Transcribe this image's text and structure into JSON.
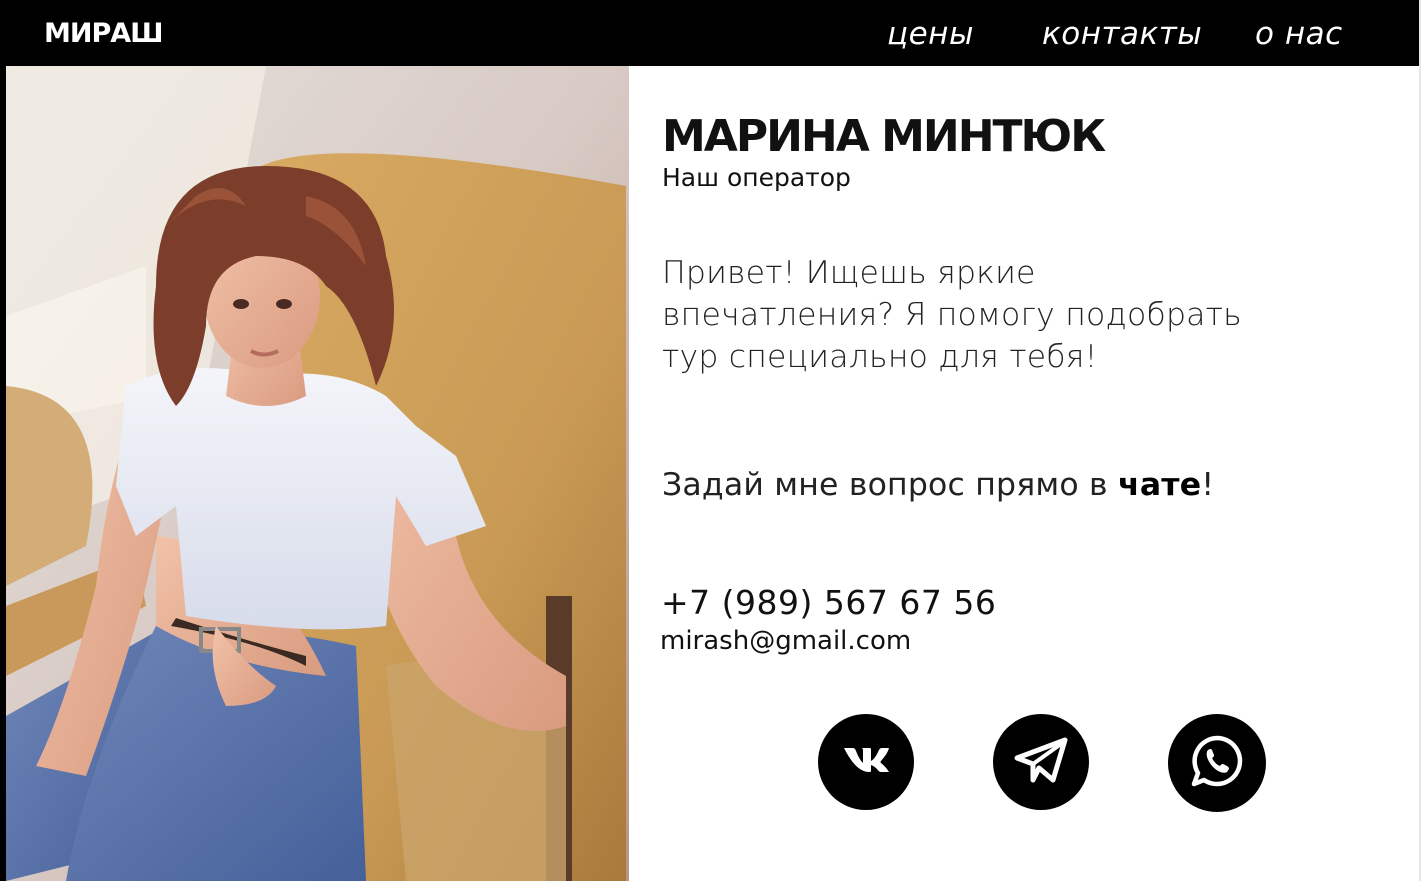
{
  "navbar": {
    "logo": "МИРАШ",
    "links": [
      "цены",
      "контакты",
      "о нас"
    ]
  },
  "profile": {
    "name": "МАРИНА МИНТЮК",
    "role": "Наш оператор",
    "intro_lines": [
      "Привет! Ищешь яркие",
      "впечатления? Я помогу подобрать",
      "тур специально для тебя!"
    ],
    "chat_prefix": "Задай мне вопрос прямо в ",
    "chat_word": "чате",
    "chat_suffix": "!",
    "phone": "+7 (989) 567 67 56",
    "email": "mirash@gmail.com"
  },
  "social": {
    "icons": [
      "vk-icon",
      "telegram-icon",
      "whatsapp-icon"
    ]
  },
  "colors": {
    "background": "#ffffff",
    "navbar": "#000000",
    "text": "#111111",
    "icon_bg": "#000000"
  }
}
